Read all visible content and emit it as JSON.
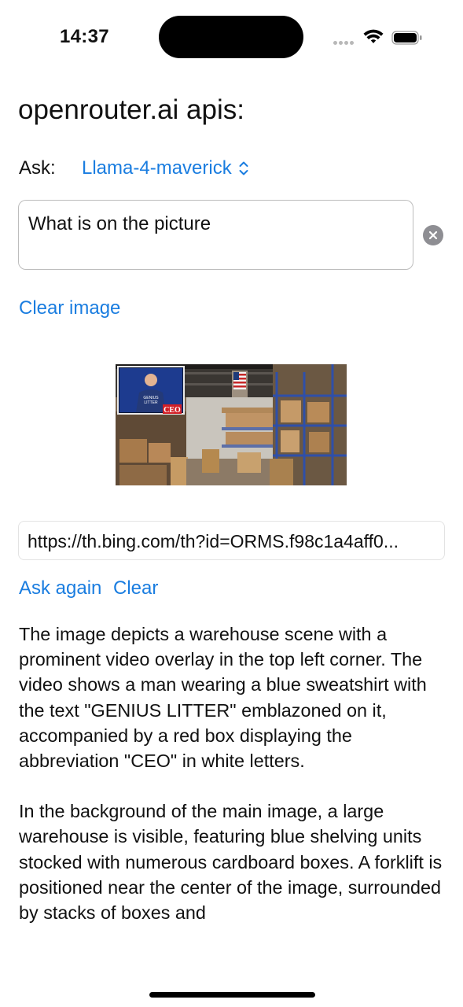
{
  "status_bar": {
    "time": "14:37"
  },
  "header": {
    "title": "openrouter.ai apis:"
  },
  "ask": {
    "label": "Ask:",
    "model": "Llama-4-maverick"
  },
  "prompt": {
    "value": "What is on the picture"
  },
  "actions": {
    "clear_image": "Clear image",
    "ask_again": "Ask again",
    "clear": "Clear"
  },
  "url_field": {
    "value": "https://th.bing.com/th?id=ORMS.f98c1a4aff0..."
  },
  "image_preview": {
    "overlay_badge": "CEO",
    "shirt_text": "GENIUS LITTER"
  },
  "response": {
    "paragraphs": [
      "The image depicts a warehouse scene with a prominent video overlay in the top left corner. The video shows a man wearing a blue sweatshirt with the text \"GENIUS LITTER\" emblazoned on it, accompanied by a red box displaying the abbreviation \"CEO\" in white letters.",
      "In the background of the main image, a large warehouse is visible, featuring blue shelving units stocked with numerous cardboard boxes. A forklift is positioned near the center of the image, surrounded by stacks of boxes and"
    ]
  },
  "colors": {
    "accent": "#1a7de0",
    "border": "#bdbdbd",
    "clear_icon": "#8e8e93"
  }
}
